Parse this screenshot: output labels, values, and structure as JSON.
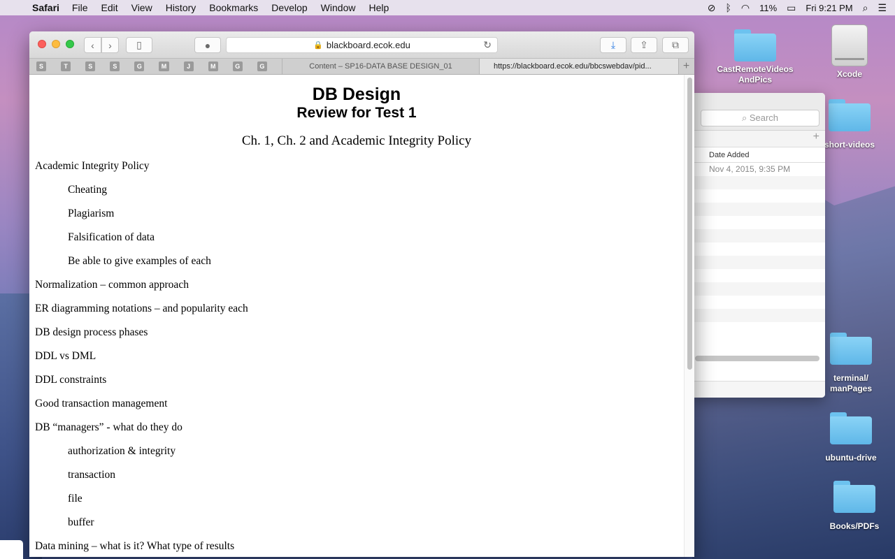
{
  "menubar": {
    "apple": "",
    "items": [
      "Safari",
      "File",
      "Edit",
      "View",
      "History",
      "Bookmarks",
      "Develop",
      "Window",
      "Help"
    ],
    "battery": "11%",
    "clock": "Fri 9:21 PM"
  },
  "desktop": {
    "icons": [
      {
        "label": "CastRemoteVideos\nAndPics"
      },
      {
        "label": "Xcode"
      },
      {
        "label": "short-videos"
      },
      {
        "label": "terminal/\nmanPages"
      },
      {
        "label": "ubuntu-drive"
      },
      {
        "label": "Books/PDFs"
      }
    ]
  },
  "finder": {
    "search_placeholder": "Search",
    "column_header": "Date Added",
    "rows": [
      "Nov 4, 2015, 9:35 PM"
    ],
    "partial_label": "s"
  },
  "safari": {
    "address": "blackboard.ecok.edu",
    "pinned_tabs": [
      "S",
      "T",
      "S",
      "S",
      "G",
      "M",
      "J",
      "M",
      "G",
      "G"
    ],
    "tabs": [
      {
        "title": "Content – SP16-DATA BASE DESIGN_01"
      },
      {
        "title": "https://blackboard.ecok.edu/bbcswebdav/pid..."
      }
    ]
  },
  "document": {
    "title": "DB Design",
    "subtitle": "Review for Test 1",
    "chapters": "Ch. 1, Ch. 2 and Academic Integrity Policy",
    "lines": [
      {
        "text": "Academic Integrity Policy",
        "indent": 0
      },
      {
        "text": "Cheating",
        "indent": 1
      },
      {
        "text": "Plagiarism",
        "indent": 1
      },
      {
        "text": "Falsification of data",
        "indent": 1
      },
      {
        "text": "Be able to give examples of each",
        "indent": 1
      },
      {
        "text": "Normalization – common approach",
        "indent": 0
      },
      {
        "text": "ER diagramming notations – and popularity each",
        "indent": 0
      },
      {
        "text": "DB design process phases",
        "indent": 0
      },
      {
        "text": "DDL vs DML",
        "indent": 0
      },
      {
        "text": "DDL constraints",
        "indent": 0
      },
      {
        "text": "Good transaction management",
        "indent": 0
      },
      {
        "text": "DB “managers” - what do they do",
        "indent": 0
      },
      {
        "text": "authorization & integrity",
        "indent": 1
      },
      {
        "text": "transaction",
        "indent": 1
      },
      {
        "text": "file",
        "indent": 1
      },
      {
        "text": "buffer",
        "indent": 1
      },
      {
        "text": "Data mining – what is it? What type of results",
        "indent": 0
      }
    ]
  }
}
